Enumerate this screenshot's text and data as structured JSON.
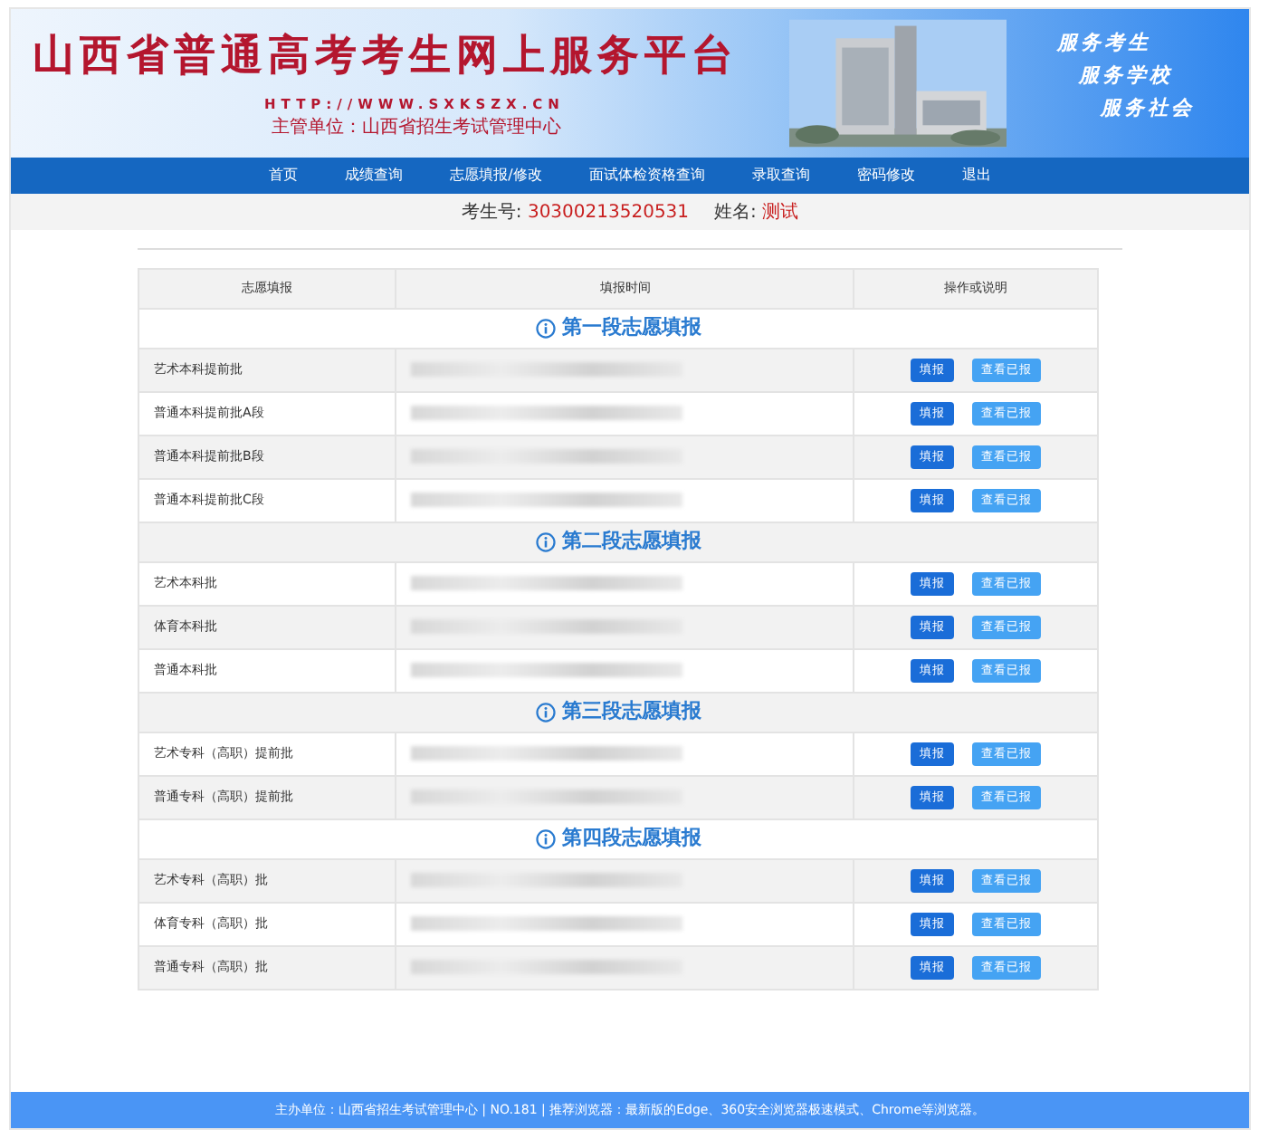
{
  "banner": {
    "title": "山西省普通高考考生网上服务平台",
    "url": "HTTP://WWW.SXKSZX.CN",
    "supervisor": "主管单位：山西省招生考试管理中心",
    "slogans": [
      "服务考生",
      "服务学校",
      "服务社会"
    ]
  },
  "nav": [
    "首页",
    "成绩查询",
    "志愿填报/修改",
    "面试体检资格查询",
    "录取查询",
    "密码修改",
    "退出"
  ],
  "student": {
    "id_label": "考生号:",
    "id": "30300213520531",
    "name_label": "姓名:",
    "name": "测试"
  },
  "table": {
    "columns": [
      "志愿填报",
      "填报时间",
      "操作或说明"
    ],
    "sections": [
      {
        "title": "第一段志愿填报",
        "rows": [
          {
            "batch": "艺术本科提前批",
            "time_redacted": true,
            "buttons": [
              "填报",
              "查看已报"
            ]
          },
          {
            "batch": "普通本科提前批A段",
            "time_redacted": true,
            "buttons": [
              "填报",
              "查看已报"
            ]
          },
          {
            "batch": "普通本科提前批B段",
            "time_redacted": true,
            "buttons": [
              "填报",
              "查看已报"
            ]
          },
          {
            "batch": "普通本科提前批C段",
            "time_redacted": true,
            "buttons": [
              "填报",
              "查看已报"
            ]
          }
        ]
      },
      {
        "title": "第二段志愿填报",
        "rows": [
          {
            "batch": "艺术本科批",
            "time_redacted": true,
            "buttons": [
              "填报",
              "查看已报"
            ]
          },
          {
            "batch": "体育本科批",
            "time_redacted": true,
            "buttons": [
              "填报",
              "查看已报"
            ]
          },
          {
            "batch": "普通本科批",
            "time_redacted": true,
            "buttons": [
              "填报",
              "查看已报"
            ]
          }
        ]
      },
      {
        "title": "第三段志愿填报",
        "rows": [
          {
            "batch": "艺术专科（高职）提前批",
            "time_redacted": true,
            "buttons": [
              "填报",
              "查看已报"
            ]
          },
          {
            "batch": "普通专科（高职）提前批",
            "time_redacted": true,
            "buttons": [
              "填报",
              "查看已报"
            ]
          }
        ]
      },
      {
        "title": "第四段志愿填报",
        "rows": [
          {
            "batch": "艺术专科（高职）批",
            "time_redacted": true,
            "buttons": [
              "填报",
              "查看已报"
            ]
          },
          {
            "batch": "体育专科（高职）批",
            "time_redacted": true,
            "buttons": [
              "填报",
              "查看已报"
            ]
          },
          {
            "batch": "普通专科（高职）批",
            "time_redacted": true,
            "buttons": [
              "填报",
              "查看已报"
            ]
          }
        ]
      }
    ]
  },
  "footer": "主办单位：山西省招生考试管理中心 | NO.181 | 推荐浏览器：最新版的Edge、360安全浏览器极速模式、Chrome等浏览器。"
}
